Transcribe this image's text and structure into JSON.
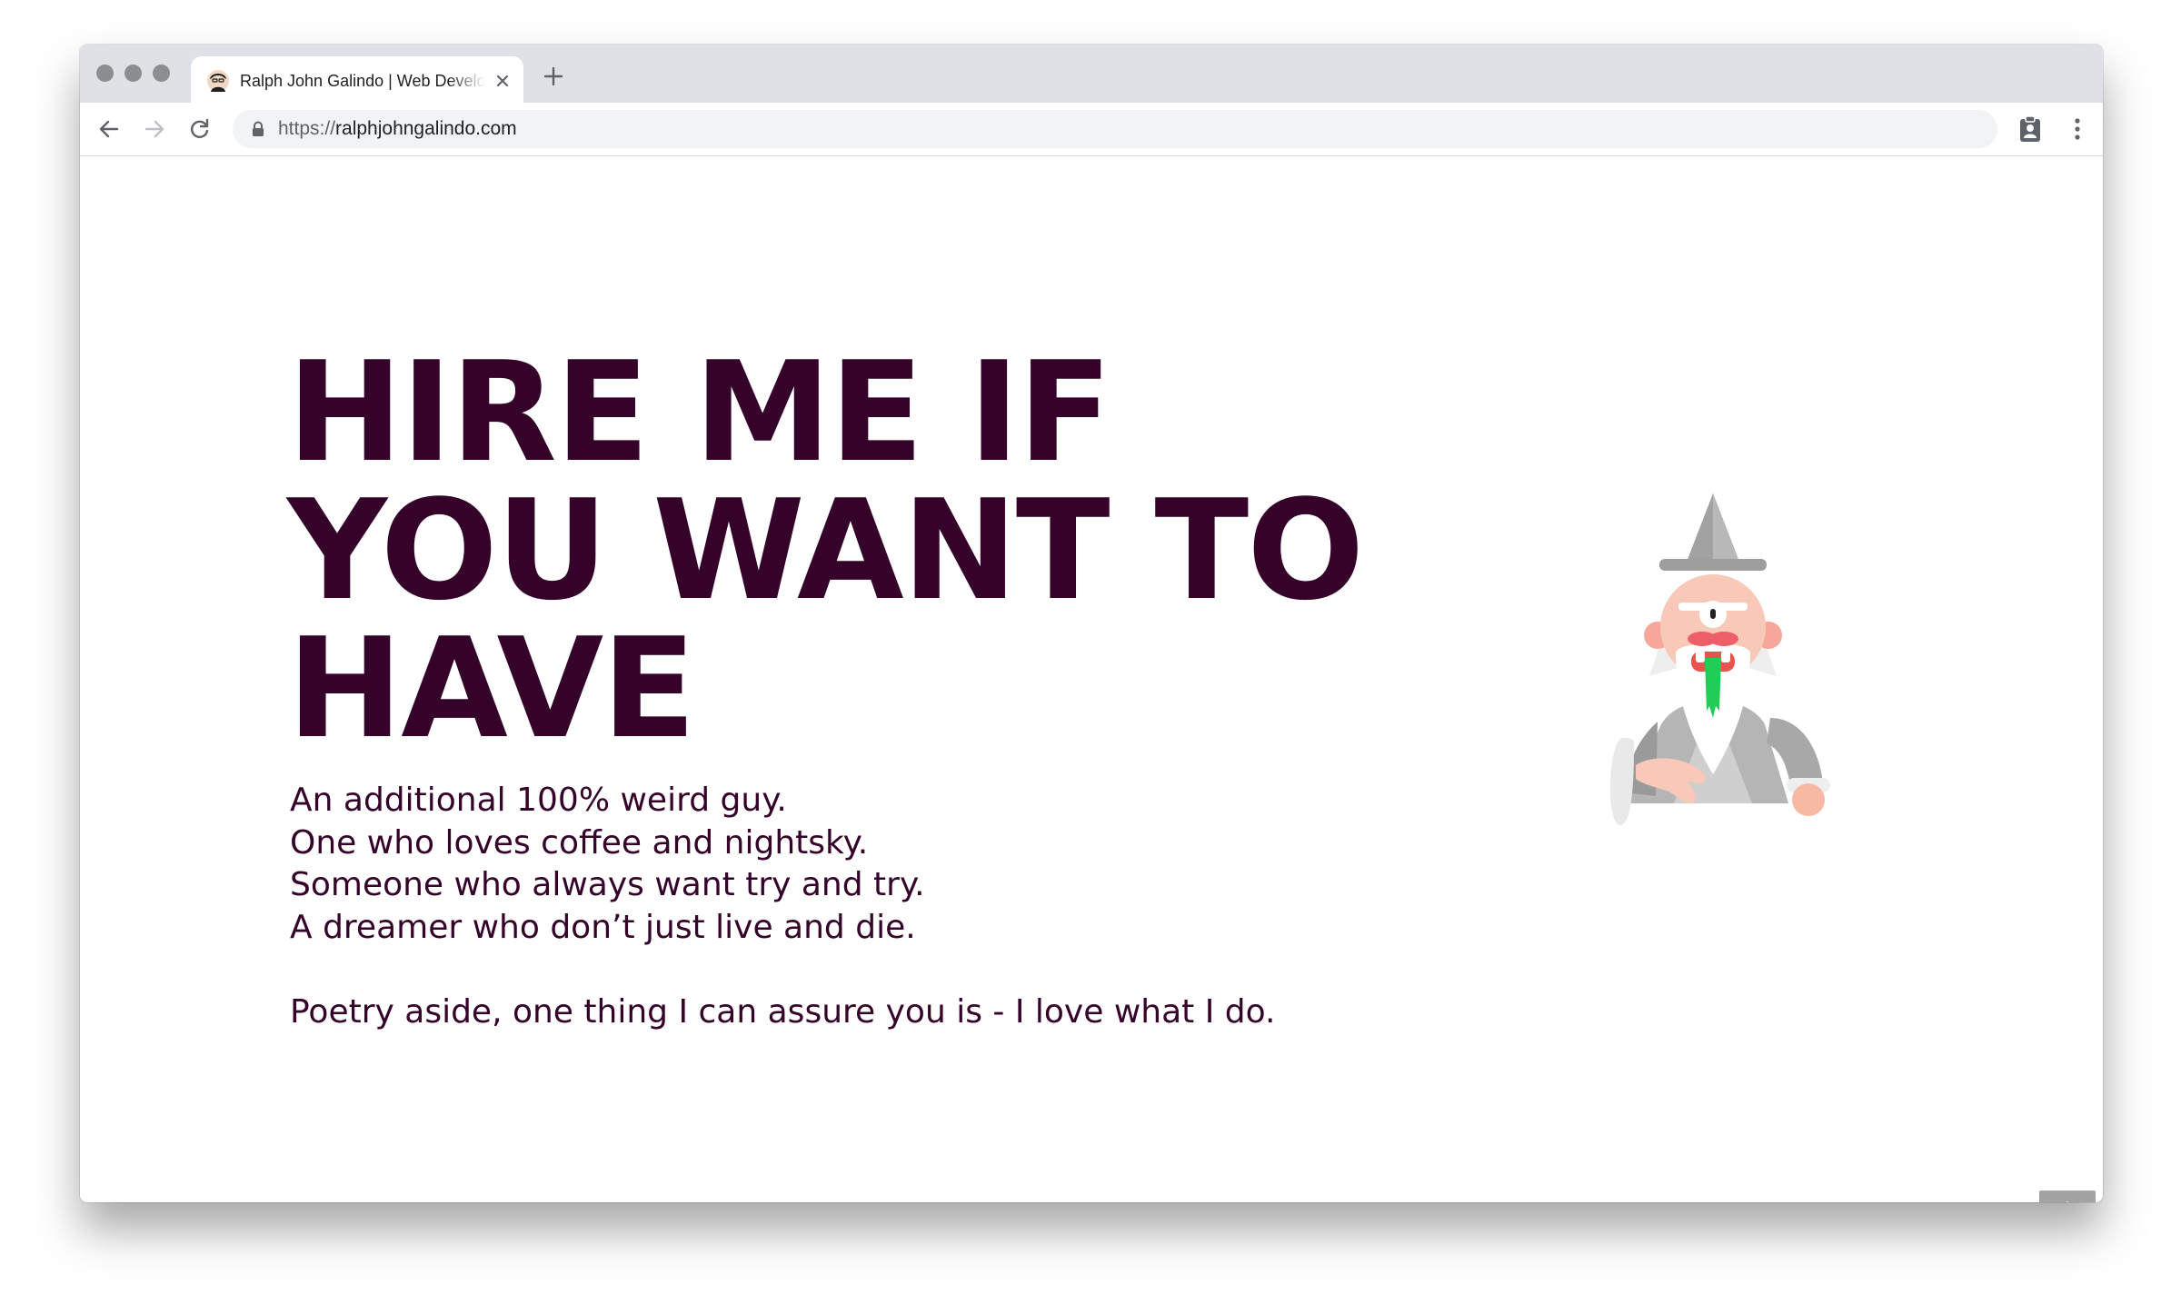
{
  "browser": {
    "tab": {
      "title": "Ralph John Galindo | Web Developer",
      "favicon": "avatar-favicon-icon"
    },
    "url": {
      "scheme": "https://",
      "host": "ralphjohngalindo.com"
    },
    "icons": {
      "back": "arrow-left-icon",
      "forward": "arrow-right-icon",
      "reload": "reload-icon",
      "lock": "lock-icon",
      "extension": "clipboard-user-icon",
      "menu": "kebab-menu-icon",
      "new_tab": "plus-icon",
      "close_tab": "close-icon"
    }
  },
  "page": {
    "headline": "HIRE ME IF\nYOU WANT TO\nHAVE",
    "intro_lines": [
      "An additional 100% weird guy.",
      "One who loves coffee and nightsky.",
      "Someone who always want try and try.",
      "A dreamer who don’t just live and die."
    ],
    "closing": "Poetry aside, one thing I can assure you is - I love what I do.",
    "illustration": "wizard-illustration",
    "back_to_top_icon": "double-chevron-up-icon"
  },
  "colors": {
    "text": "#35022a",
    "tabbar": "#dee1e6",
    "omnibox": "#f1f3f4",
    "back_to_top": "#a3a3a3"
  }
}
